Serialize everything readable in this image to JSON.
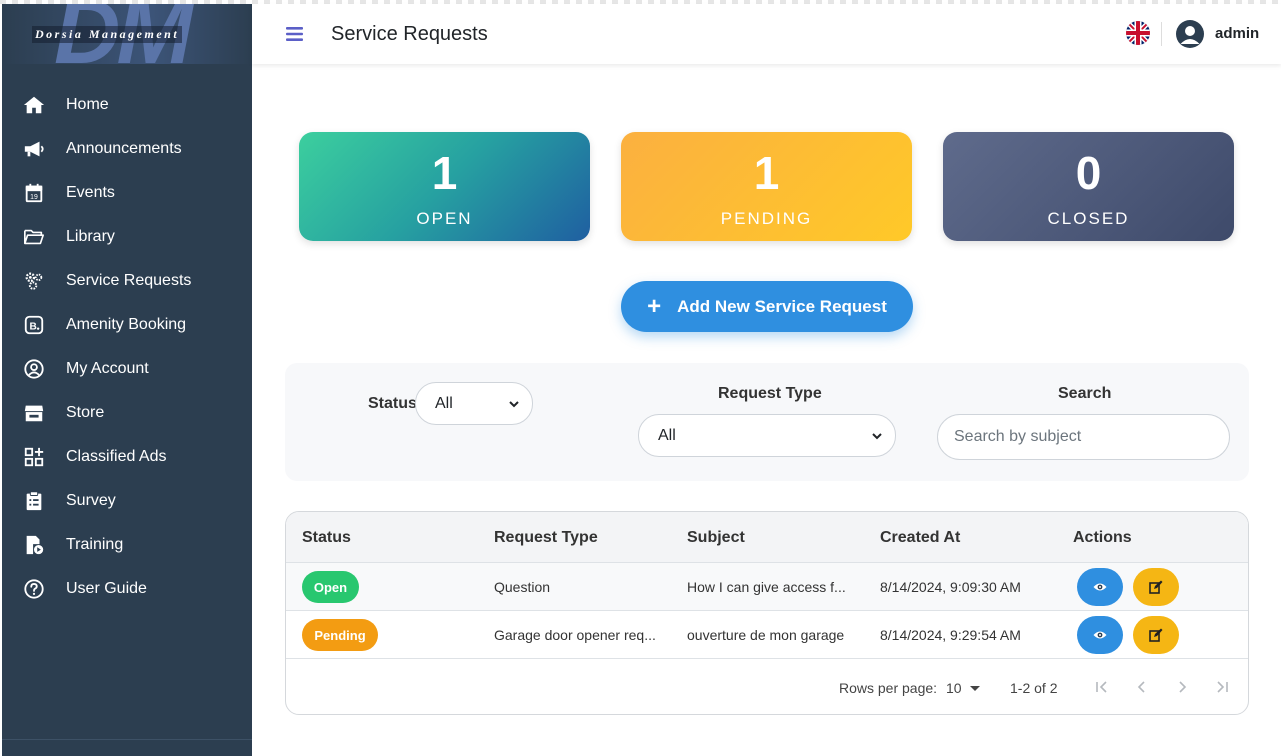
{
  "brand": {
    "logo_letters": "DM",
    "name": "Dorsia Management"
  },
  "sidebar": {
    "items": [
      {
        "label": "Home",
        "icon": "home-icon"
      },
      {
        "label": "Announcements",
        "icon": "megaphone-icon"
      },
      {
        "label": "Events",
        "icon": "calendar-icon"
      },
      {
        "label": "Library",
        "icon": "folder-open-icon"
      },
      {
        "label": "Service Requests",
        "icon": "gears-icon"
      },
      {
        "label": "Amenity Booking",
        "icon": "booking-icon"
      },
      {
        "label": "My Account",
        "icon": "user-circle-icon"
      },
      {
        "label": "Store",
        "icon": "store-icon"
      },
      {
        "label": "Classified Ads",
        "icon": "grid-plus-icon"
      },
      {
        "label": "Survey",
        "icon": "clipboard-icon"
      },
      {
        "label": "Training",
        "icon": "training-video-icon"
      },
      {
        "label": "User Guide",
        "icon": "question-circle-icon"
      }
    ],
    "calendar_day": "19"
  },
  "header": {
    "title": "Service Requests",
    "username": "admin",
    "language_icon": "uk-flag-icon"
  },
  "stats": {
    "open": {
      "count": "1",
      "label": "OPEN"
    },
    "pending": {
      "count": "1",
      "label": "PENDING"
    },
    "closed": {
      "count": "0",
      "label": "CLOSED"
    }
  },
  "add_button": {
    "label": "Add New Service Request",
    "icon": "plus-icon"
  },
  "filters": {
    "status_label": "Status",
    "status_value": "All",
    "request_type_label": "Request Type",
    "request_type_value": "All",
    "search_label": "Search",
    "search_placeholder": "Search by subject"
  },
  "table": {
    "columns": [
      "Status",
      "Request Type",
      "Subject",
      "Created At",
      "Actions"
    ],
    "rows": [
      {
        "status": "Open",
        "request_type": "Question",
        "subject": "How I can give access f...",
        "created_at": "8/14/2024, 9:09:30 AM"
      },
      {
        "status": "Pending",
        "request_type": "Garage door opener req...",
        "subject": "ouverture de mon garage",
        "created_at": "8/14/2024, 9:29:54 AM"
      }
    ]
  },
  "pagination": {
    "rows_per_page_label": "Rows per page:",
    "rows_per_page": "10",
    "range": "1-2 of 2"
  },
  "colors": {
    "sidebar": "#2c3e50",
    "accent": "#2f8fe0",
    "open": "#28c76f",
    "pending": "#f39c12",
    "edit": "#f5b614",
    "menu": "#5b5fc7"
  }
}
